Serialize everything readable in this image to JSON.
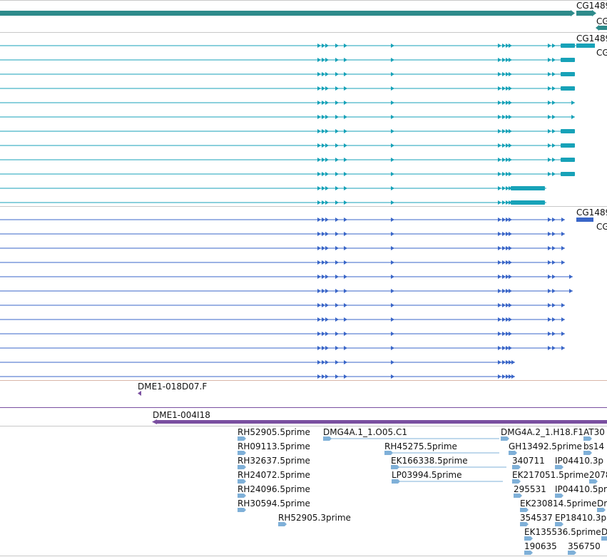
{
  "colors": {
    "gene": "#2e8b8b",
    "transcript_mrna": "#17a2b8",
    "transcript_protein": "#3a66c8",
    "clone": "#7a4fa0",
    "est": "#7fb0d8",
    "divider": "#c8c8c8",
    "divider_accent": "#d9b7a8"
  },
  "tracks": {
    "gene_track": {
      "labels": [
        "CG1489",
        "CG"
      ]
    },
    "mrna_track": {
      "labels": [
        "CG1489",
        "CG"
      ],
      "row_count": 12
    },
    "protein_track": {
      "labels": [
        "CG1489",
        "CG"
      ],
      "row_count": 12
    },
    "clone_track_1": {
      "labels": [
        "DME1-018D07.F"
      ]
    },
    "clone_track_2": {
      "labels": [
        "DME1-004I18"
      ]
    },
    "est_track": {
      "labels": [
        "RH52905.5prime",
        "RH09113.5prime",
        "RH32637.5prime",
        "RH24072.5prime",
        "RH24096.5prime",
        "RH30594.5prime",
        "RH52905.3prime",
        "DMG4A.1_1.O05.C1",
        "RH45275.5prime",
        "EK166338.5prime",
        "LP03994.5prime",
        "DMG4A.2_1.H18.F1",
        "AT30",
        "GH13492.5prime",
        "340711",
        "IP04410.3p",
        "bs14",
        "EK217051.5prime",
        "2078",
        "295531",
        "IP04410.5prime",
        "EK230814.5prime",
        "Dr",
        "354537",
        "EP18410.3p",
        "EK135536.5prime",
        "D",
        "190635",
        "356750"
      ]
    }
  }
}
